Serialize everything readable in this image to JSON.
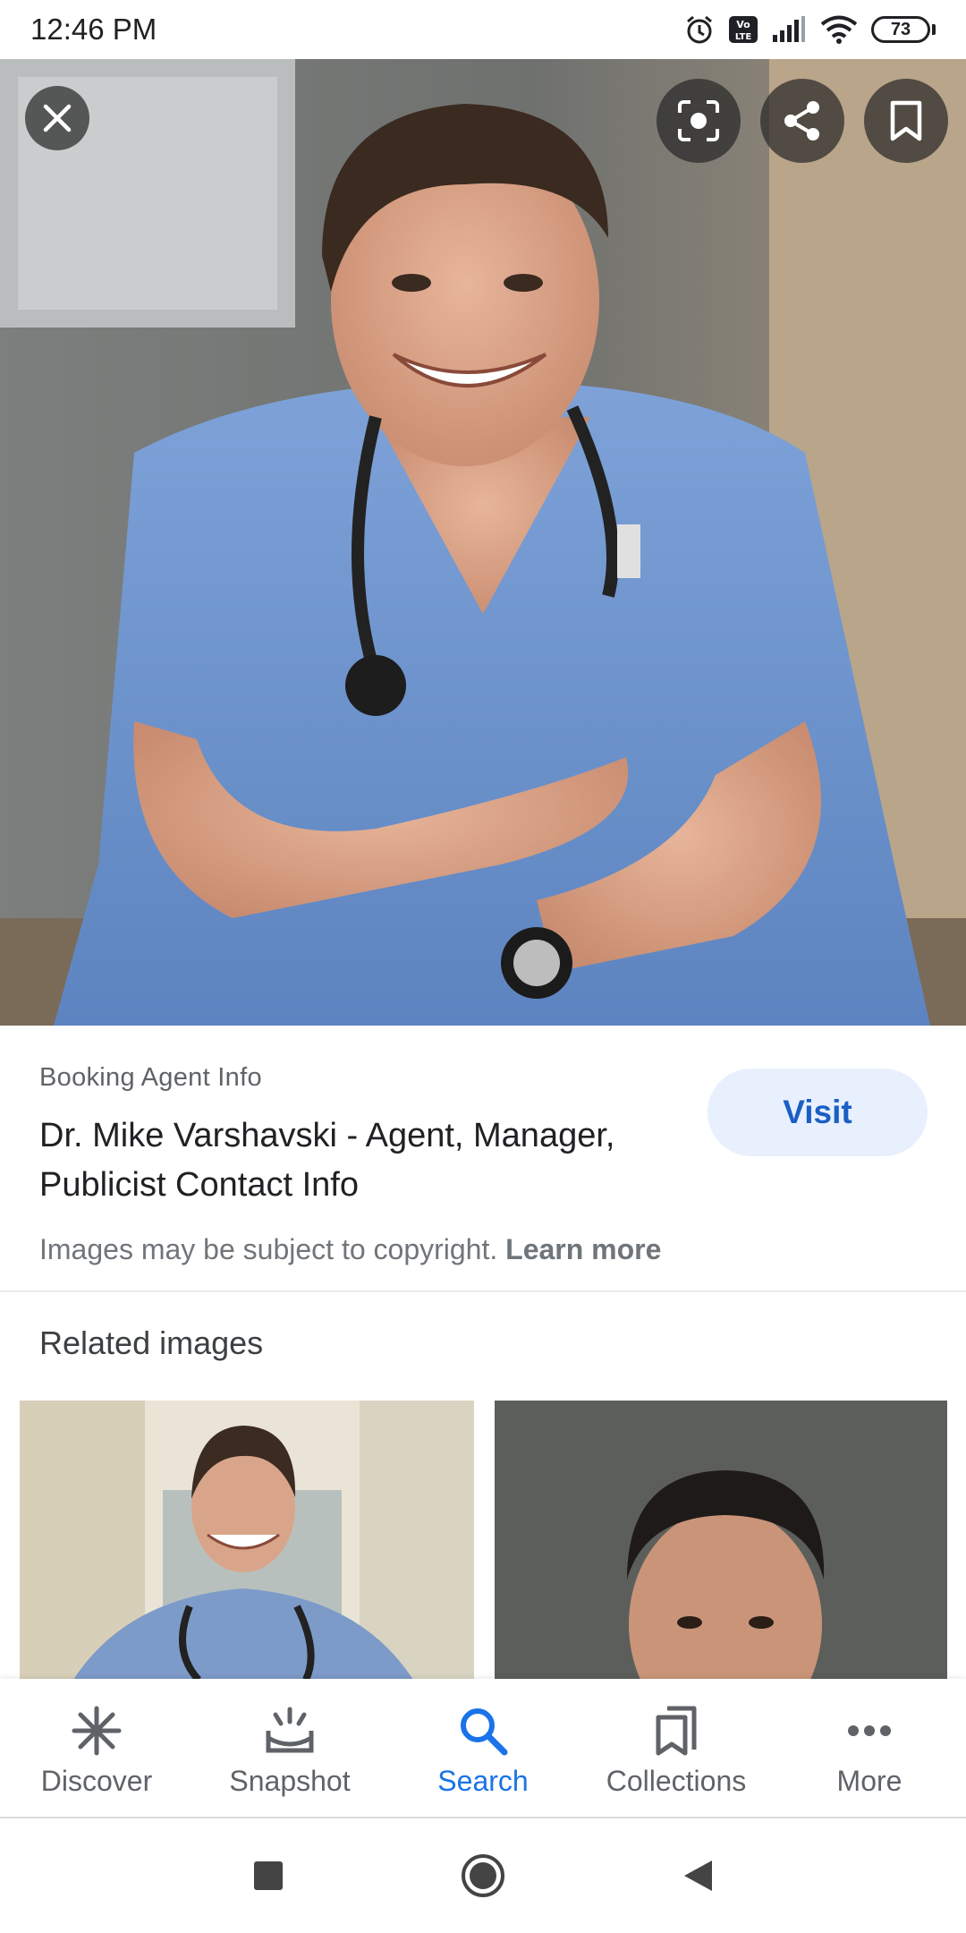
{
  "status_bar": {
    "time": "12:46 PM",
    "battery_level": "73",
    "icons": [
      "alarm-icon",
      "volte-icon",
      "signal-icon",
      "wifi-icon",
      "battery-icon"
    ]
  },
  "viewer": {
    "close_icon": "close-icon",
    "lens_icon": "lens-icon",
    "share_icon": "share-icon",
    "save_icon": "bookmark-icon"
  },
  "result": {
    "source": "Booking Agent Info",
    "title": "Dr. Mike Varshavski - Agent, Manager, Publicist Contact Info",
    "visit_label": "Visit",
    "copyright_text": "Images may be subject to copyright.",
    "learn_more": "Learn more"
  },
  "related": {
    "heading": "Related images"
  },
  "bottom_nav": {
    "items": [
      {
        "label": "Discover",
        "icon": "discover-icon",
        "active": false
      },
      {
        "label": "Snapshot",
        "icon": "snapshot-icon",
        "active": false
      },
      {
        "label": "Search",
        "icon": "search-icon",
        "active": true
      },
      {
        "label": "Collections",
        "icon": "collections-icon",
        "active": false
      },
      {
        "label": "More",
        "icon": "more-icon",
        "active": false
      }
    ]
  },
  "colors": {
    "accent": "#1a73e8",
    "visit_bg": "#e8f0fe",
    "text_primary": "#202124",
    "text_secondary": "#5f6368"
  }
}
